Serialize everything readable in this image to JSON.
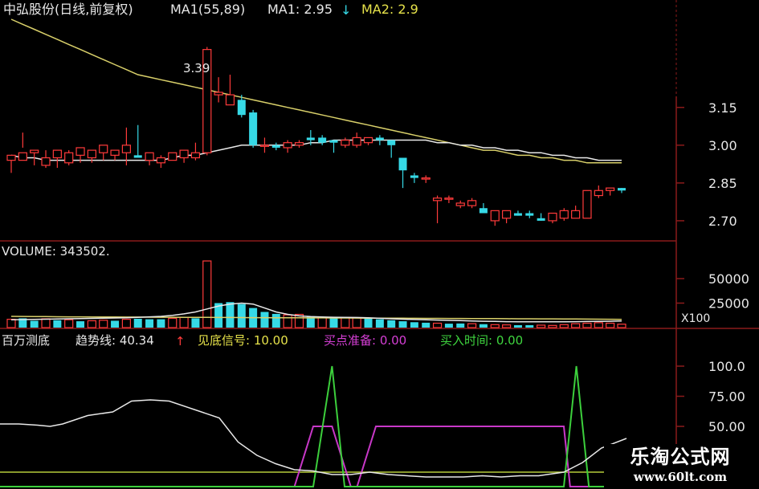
{
  "colors": {
    "up": "#ff3b3b",
    "down": "#36d9e6",
    "ma_long": "#d9d06a",
    "ma_short": "#e8e8e8",
    "grid": "#8b1a1a",
    "text_white": "#e8e8e8",
    "text_yellow": "#e6e24a",
    "text_magenta": "#d63fd6",
    "text_green": "#3fd63f",
    "trend": "#e8e8e8",
    "signal_magenta": "#c838c8",
    "signal_green": "#3ccf3c",
    "baseline": "#b5cc3a"
  },
  "header": {
    "stock": "中弘股份(日线,前复权)",
    "ma_params": "MA1(55,89)",
    "ma1_label": "MA1: 2.95",
    "ma2_label": "MA2: 2.9",
    "high_marker": "3.39"
  },
  "volume_header": {
    "label": "VOLUME: 343502."
  },
  "indicator_header": {
    "name": "百万测底",
    "trend_label": "趋势线: 40.34",
    "bottom_signal": "见底信号: 10.00",
    "buy_prepare": "买点准备: 0.00",
    "buy_time": "买入时间: 0.00"
  },
  "watermark": {
    "cn": "乐淘公式网",
    "url": "www.60lt.com"
  },
  "chart_data": [
    {
      "type": "candlestick",
      "axis_ticks": [
        "3.15",
        "3.00",
        "2.85",
        "2.70"
      ],
      "ylim": [
        2.62,
        3.5
      ],
      "candles": [
        [
          2.94,
          2.95,
          2.89,
          2.96
        ],
        [
          2.94,
          3.05,
          2.99,
          2.97
        ],
        [
          2.97,
          2.97,
          2.92,
          2.98
        ],
        [
          2.92,
          2.98,
          2.91,
          2.95
        ],
        [
          2.95,
          2.95,
          2.91,
          2.98
        ],
        [
          2.93,
          2.98,
          2.92,
          2.97
        ],
        [
          2.96,
          2.96,
          2.93,
          2.99
        ],
        [
          2.95,
          2.98,
          2.93,
          2.98
        ],
        [
          2.97,
          2.99,
          2.94,
          3.0
        ],
        [
          2.96,
          2.97,
          2.94,
          2.98
        ],
        [
          2.97,
          3.07,
          2.92,
          3.0
        ],
        [
          2.96,
          3.08,
          2.95,
          2.95
        ],
        [
          2.94,
          2.95,
          2.92,
          2.97
        ],
        [
          2.93,
          2.96,
          2.91,
          2.95
        ],
        [
          2.94,
          2.96,
          2.94,
          2.97
        ],
        [
          2.95,
          2.96,
          2.93,
          2.98
        ],
        [
          2.95,
          3.01,
          2.94,
          2.97
        ],
        [
          2.97,
          3.39,
          2.96,
          3.38
        ],
        [
          3.2,
          3.27,
          3.17,
          3.21
        ],
        [
          3.16,
          3.28,
          3.16,
          3.2
        ],
        [
          3.18,
          3.2,
          3.11,
          3.12
        ],
        [
          3.13,
          3.14,
          2.99,
          3.0
        ],
        [
          3.0,
          3.03,
          2.97,
          3.0
        ],
        [
          3.0,
          3.01,
          2.98,
          2.99
        ],
        [
          2.99,
          3.02,
          2.97,
          3.01
        ],
        [
          3.0,
          3.02,
          2.99,
          3.01
        ],
        [
          3.03,
          3.06,
          3.0,
          3.02
        ],
        [
          3.03,
          3.04,
          3.0,
          3.01
        ],
        [
          3.02,
          3.02,
          2.97,
          3.01
        ],
        [
          3.0,
          3.03,
          2.99,
          3.02
        ],
        [
          3.0,
          3.05,
          2.99,
          3.03
        ],
        [
          3.01,
          3.03,
          3.0,
          3.03
        ],
        [
          3.03,
          3.04,
          3.0,
          3.02
        ],
        [
          3.02,
          3.02,
          2.95,
          3.0
        ],
        [
          2.95,
          2.95,
          2.83,
          2.9
        ],
        [
          2.88,
          2.89,
          2.85,
          2.87
        ],
        [
          2.87,
          2.88,
          2.85,
          2.87
        ],
        [
          2.78,
          2.8,
          2.69,
          2.79
        ],
        [
          2.79,
          2.8,
          2.77,
          2.79
        ],
        [
          2.76,
          2.78,
          2.75,
          2.77
        ],
        [
          2.76,
          2.79,
          2.75,
          2.78
        ],
        [
          2.75,
          2.77,
          2.73,
          2.73
        ],
        [
          2.7,
          2.72,
          2.68,
          2.74
        ],
        [
          2.71,
          2.74,
          2.69,
          2.74
        ],
        [
          2.73,
          2.74,
          2.72,
          2.72
        ],
        [
          2.73,
          2.74,
          2.71,
          2.72
        ],
        [
          2.71,
          2.73,
          2.7,
          2.7
        ],
        [
          2.7,
          2.72,
          2.69,
          2.73
        ],
        [
          2.71,
          2.75,
          2.7,
          2.74
        ],
        [
          2.71,
          2.76,
          2.71,
          2.74
        ],
        [
          2.71,
          2.81,
          2.71,
          2.82
        ],
        [
          2.8,
          2.84,
          2.79,
          2.82
        ],
        [
          2.82,
          2.83,
          2.8,
          2.83
        ],
        [
          2.83,
          2.83,
          2.81,
          2.82
        ]
      ],
      "ma_short": [
        2.96,
        2.95,
        2.95,
        2.94,
        2.94,
        2.94,
        2.94,
        2.94,
        2.94,
        2.94,
        2.94,
        2.94,
        2.94,
        2.94,
        2.95,
        2.96,
        2.96,
        2.97,
        2.98,
        2.99,
        3.0,
        3.0,
        3.0,
        3.0,
        3.0,
        3.0,
        3.01,
        3.01,
        3.02,
        3.02,
        3.02,
        3.02,
        3.02,
        3.02,
        3.02,
        3.02,
        3.02,
        3.01,
        3.01,
        3.0,
        3.0,
        2.99,
        2.99,
        2.98,
        2.98,
        2.97,
        2.97,
        2.96,
        2.96,
        2.95,
        2.95,
        2.94,
        2.94,
        2.94
      ],
      "ma_long": [
        3.5,
        3.48,
        3.46,
        3.44,
        3.42,
        3.4,
        3.38,
        3.36,
        3.34,
        3.32,
        3.3,
        3.28,
        3.27,
        3.26,
        3.25,
        3.24,
        3.23,
        3.22,
        3.21,
        3.2,
        3.19,
        3.18,
        3.17,
        3.16,
        3.15,
        3.14,
        3.13,
        3.12,
        3.11,
        3.1,
        3.09,
        3.08,
        3.07,
        3.06,
        3.05,
        3.04,
        3.03,
        3.02,
        3.01,
        3.0,
        2.99,
        2.98,
        2.98,
        2.97,
        2.96,
        2.96,
        2.95,
        2.95,
        2.94,
        2.94,
        2.93,
        2.93,
        2.93,
        2.93
      ]
    },
    {
      "type": "bar",
      "axis_ticks": [
        "50000",
        "25000"
      ],
      "unit_label": "X100",
      "ylim": [
        0,
        68000
      ],
      "values": [
        8500,
        9500,
        7000,
        9000,
        7500,
        8000,
        6500,
        7000,
        7500,
        7000,
        8500,
        9000,
        8500,
        8500,
        9500,
        10500,
        9500,
        68000,
        25000,
        26000,
        24000,
        20000,
        16000,
        14000,
        13000,
        13500,
        11500,
        10500,
        10500,
        10500,
        10000,
        9500,
        8500,
        7500,
        6500,
        5500,
        5000,
        4500,
        4000,
        4200,
        4000,
        3500,
        3000,
        2800,
        2500,
        2500,
        2500,
        2200,
        3000,
        4000,
        4500,
        5000,
        4500,
        3500
      ],
      "up": [
        true,
        false,
        false,
        true,
        false,
        true,
        false,
        true,
        true,
        false,
        true,
        false,
        false,
        false,
        true,
        true,
        false,
        true,
        false,
        false,
        false,
        false,
        false,
        false,
        true,
        true,
        false,
        true,
        false,
        true,
        true,
        false,
        false,
        false,
        false,
        false,
        false,
        true,
        false,
        false,
        true,
        false,
        true,
        true,
        false,
        false,
        true,
        true,
        true,
        true,
        true,
        true,
        true,
        true
      ],
      "ma_short": [
        8000,
        8200,
        8400,
        8600,
        8800,
        9000,
        9200,
        9400,
        9600,
        9800,
        10000,
        10500,
        11000,
        11500,
        12500,
        14000,
        16000,
        19000,
        22000,
        24000,
        25000,
        24000,
        20000,
        16000,
        13500,
        12000,
        11200,
        10800,
        10600,
        10500,
        10300,
        10000,
        9500,
        9000,
        8600,
        8300,
        8000,
        7700,
        7400,
        7100,
        6800,
        6500,
        6300,
        6100,
        6000,
        5900,
        5900,
        5900,
        6000,
        6100,
        6200,
        6300,
        6500,
        6800
      ],
      "ma_long": [
        11500,
        11400,
        11300,
        11200,
        11100,
        11000,
        10950,
        10900,
        10850,
        10800,
        10750,
        10700,
        10650,
        10600,
        10550,
        10500,
        10450,
        10400,
        10350,
        10300,
        10250,
        10200,
        10150,
        10100,
        10050,
        10000,
        9950,
        9900,
        9850,
        9800,
        9750,
        9700,
        9650,
        9600,
        9550,
        9500,
        9450,
        9400,
        9350,
        9300,
        9250,
        9200,
        9150,
        9100,
        9050,
        9000,
        8950,
        8900,
        8850,
        8800,
        8700,
        8600,
        8500,
        8400
      ]
    },
    {
      "type": "line",
      "axis_ticks": [
        "100.0",
        "75.00",
        "50.00"
      ],
      "ylim": [
        0,
        112
      ],
      "x": [
        0,
        0.03,
        0.06,
        0.08,
        0.1,
        0.14,
        0.18,
        0.21,
        0.24,
        0.27,
        0.31,
        0.35,
        0.38,
        0.41,
        0.44,
        0.47,
        0.5,
        0.53,
        0.56,
        0.59,
        0.62,
        0.65,
        0.68,
        0.71,
        0.74,
        0.77,
        0.8,
        0.83,
        0.86,
        0.9,
        0.93,
        0.96,
        1.0
      ],
      "trend": [
        52,
        52,
        51,
        50,
        52,
        59,
        62,
        71,
        72,
        71,
        64,
        57,
        37,
        26,
        19,
        14,
        13,
        10,
        10,
        12,
        10,
        9,
        8,
        8,
        8,
        9,
        8,
        9,
        9,
        12,
        20,
        32,
        40
      ],
      "signal_magenta": {
        "x": [
          0,
          0.47,
          0.5,
          0.53,
          0.56,
          0.57,
          0.6,
          0.64,
          0.67,
          0.7,
          0.87,
          0.9,
          0.91,
          0.92,
          1.0
        ],
        "y": [
          0,
          0,
          50,
          50,
          0,
          0,
          50,
          50,
          50,
          50,
          50,
          50,
          0,
          0,
          0
        ]
      },
      "signal_green": {
        "x": [
          0,
          0.5,
          0.53,
          0.55,
          0.9,
          0.92,
          0.94,
          1.0
        ],
        "y": [
          0,
          0,
          100,
          0,
          0,
          100,
          0,
          0
        ]
      },
      "baseline": 12
    }
  ]
}
